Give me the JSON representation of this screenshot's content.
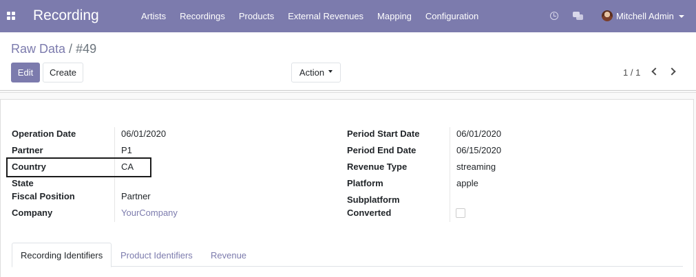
{
  "navbar": {
    "app_name": "Recording",
    "menu": [
      "Artists",
      "Recordings",
      "Products",
      "External Revenues",
      "Mapping",
      "Configuration"
    ],
    "user": "Mitchell Admin",
    "icons": [
      "apps-icon",
      "activity-clock-icon",
      "chat-icon",
      "user-avatar"
    ]
  },
  "breadcrumb": {
    "parent": "Raw Data",
    "separator": "/",
    "current": "#49"
  },
  "buttons": {
    "edit": "Edit",
    "create": "Create",
    "action": "Action"
  },
  "pager": {
    "value": "1 / 1"
  },
  "form": {
    "left": [
      {
        "label": "Operation Date",
        "value": "06/01/2020"
      },
      {
        "label": "Partner",
        "value": "P1"
      },
      {
        "label": "Country",
        "value": "CA"
      },
      {
        "label": "State",
        "value": ""
      },
      {
        "label": "Fiscal Position",
        "value": "Partner"
      },
      {
        "label": "Company",
        "value": "YourCompany"
      }
    ],
    "right": [
      {
        "label": "Period Start Date",
        "value": "06/01/2020"
      },
      {
        "label": "Period End Date",
        "value": "06/15/2020"
      },
      {
        "label": "Revenue Type",
        "value": "streaming"
      },
      {
        "label": "Platform",
        "value": "apple"
      },
      {
        "label": "Subplatform",
        "value": ""
      },
      {
        "label": "Converted",
        "value": ""
      }
    ],
    "converted_checked": false
  },
  "tabs": [
    "Recording Identifiers",
    "Product Identifiers",
    "Revenue"
  ],
  "colors": {
    "brand": "#7c7bad"
  }
}
